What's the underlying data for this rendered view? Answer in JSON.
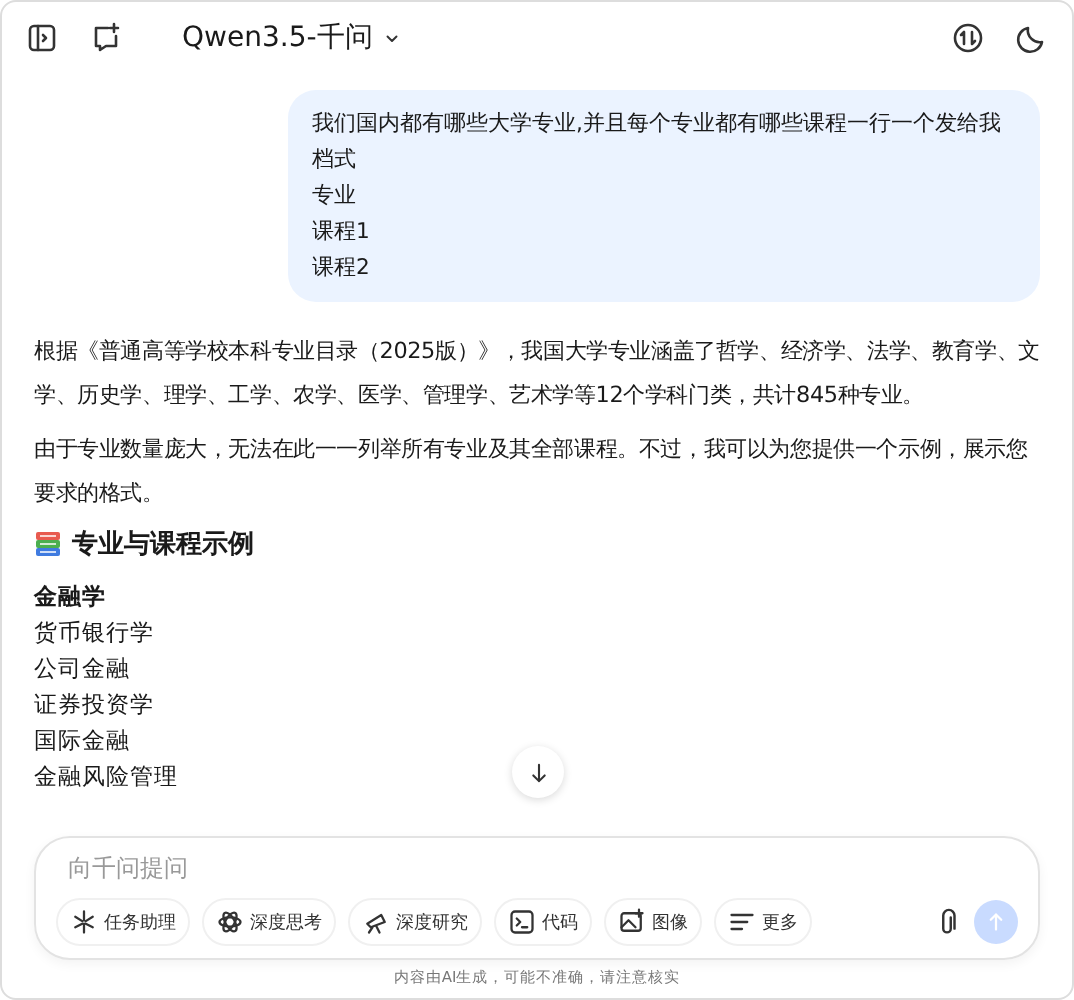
{
  "header": {
    "model": "Qwen3.5-千问"
  },
  "user_message": {
    "lines": [
      "我们国内都有哪些大学专业,并且每个专业都有哪些课程一行一个发给我",
      "档式",
      "专业",
      "课程1",
      "课程2"
    ]
  },
  "answer": {
    "paragraphs": [
      "根据《普通高等学校本科专业目录（2025版）》，我国大学专业涵盖了哲学、经济学、法学、教育学、文学、历史学、理学、工学、农学、医学、管理学、艺术学等12个学科门类，共计845种专业。",
      "由于专业数量庞大，无法在此一一列举所有专业及其全部课程。不过，我可以为您提供一个示例，展示您要求的格式。"
    ],
    "heading": "专业与课程示例",
    "major": "金融学",
    "courses": [
      "货币银行学",
      "公司金融",
      "证券投资学",
      "国际金融",
      "金融风险管理"
    ]
  },
  "composer": {
    "placeholder": "向千问提问",
    "chips": [
      {
        "kind": "agent",
        "label": "任务助理"
      },
      {
        "kind": "think",
        "label": "深度思考"
      },
      {
        "kind": "research",
        "label": "深度研究"
      },
      {
        "kind": "code",
        "label": "代码"
      },
      {
        "kind": "image",
        "label": "图像"
      },
      {
        "kind": "more",
        "label": "更多"
      }
    ],
    "send_disabled": true
  },
  "disclaimer": "内容由AI生成，可能不准确，请注意核实"
}
